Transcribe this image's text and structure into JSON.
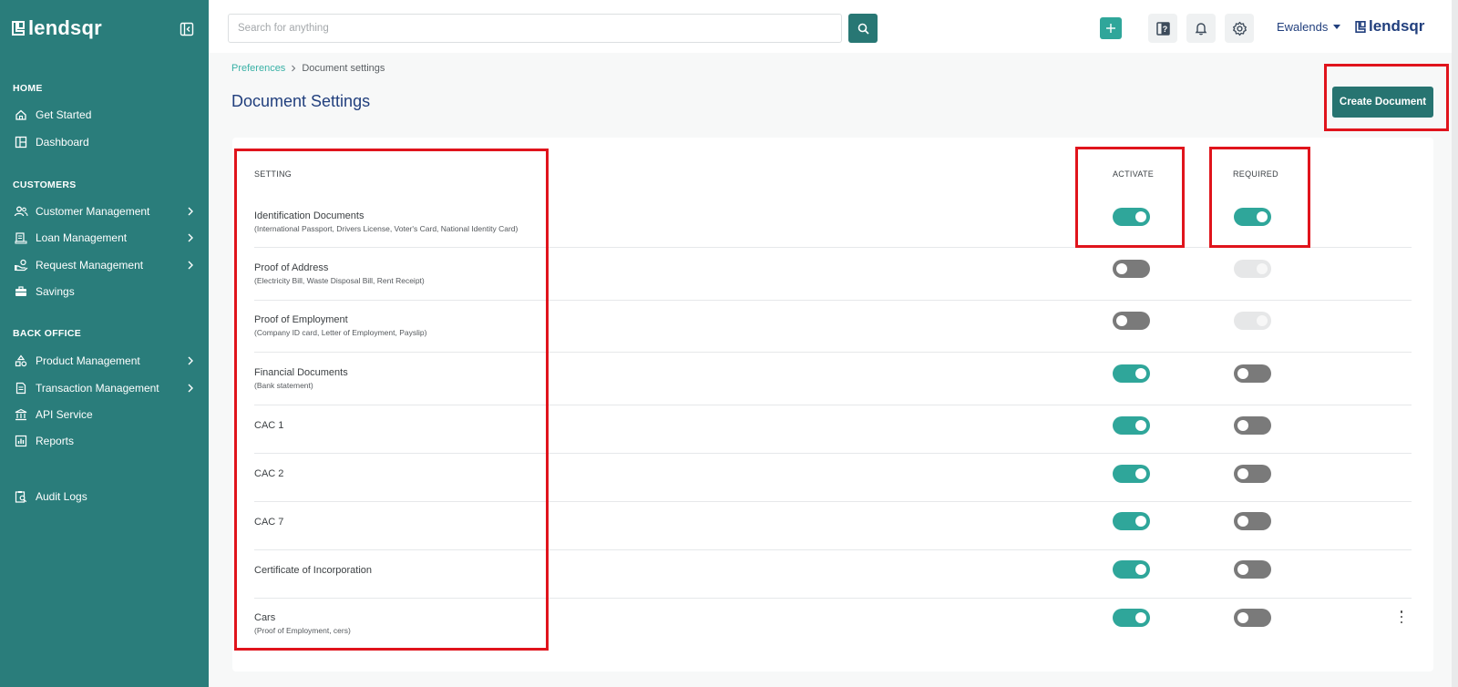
{
  "colors": {
    "sidebar_bg": "#2a7d7b",
    "accent": "#2fa69a",
    "primary_dark": "#277471",
    "title_blue": "#213f7d",
    "highlight_red": "#e0141c"
  },
  "sidebar": {
    "brand": "lendsqr",
    "sections": {
      "home": "HOME",
      "customers": "CUSTOMERS",
      "back_office": "BACK OFFICE"
    },
    "items": [
      {
        "label": "Get Started",
        "icon": "home-icon"
      },
      {
        "label": "Dashboard",
        "icon": "dashboard-icon"
      },
      {
        "label": "Customer Management",
        "icon": "users-icon",
        "has_submenu": true
      },
      {
        "label": "Loan Management",
        "icon": "loan-icon",
        "has_submenu": true
      },
      {
        "label": "Request Management",
        "icon": "request-icon",
        "has_submenu": true
      },
      {
        "label": "Savings",
        "icon": "briefcase-icon"
      },
      {
        "label": "Product Management",
        "icon": "product-icon",
        "has_submenu": true
      },
      {
        "label": "Transaction Management",
        "icon": "transaction-icon",
        "has_submenu": true
      },
      {
        "label": "API Service",
        "icon": "bank-icon"
      },
      {
        "label": "Reports",
        "icon": "report-icon"
      },
      {
        "label": "Audit Logs",
        "icon": "audit-icon"
      }
    ]
  },
  "topbar": {
    "search_placeholder": "Search for anything",
    "user_name": "Ewalends",
    "brand": "lendsqr",
    "icons": [
      "search-icon",
      "plus-icon",
      "help-book-icon",
      "bell-icon",
      "gear-icon"
    ]
  },
  "breadcrumb": {
    "parent": "Preferences",
    "current": "Document settings"
  },
  "page": {
    "title": "Document Settings",
    "create_button": "Create Document"
  },
  "table": {
    "headers": {
      "setting": "SETTING",
      "activate": "ACTIVATE",
      "required": "REQUIRED"
    },
    "rows": [
      {
        "title": "Identification Documents",
        "subtitle": "(International Passport, Drivers License, Voter's Card, National Identity Card)",
        "activate": "on",
        "required": "on"
      },
      {
        "title": "Proof of Address",
        "subtitle": "(Electricity Bill, Waste Disposal Bill, Rent Receipt)",
        "activate": "off",
        "required": "disabled"
      },
      {
        "title": "Proof of Employment",
        "subtitle": "(Company ID card, Letter of Employment, Payslip)",
        "activate": "off",
        "required": "disabled"
      },
      {
        "title": "Financial Documents",
        "subtitle": "(Bank statement)",
        "activate": "on",
        "required": "off"
      },
      {
        "title": "CAC 1",
        "subtitle": "",
        "activate": "on",
        "required": "off"
      },
      {
        "title": "CAC 2",
        "subtitle": "",
        "activate": "on",
        "required": "off"
      },
      {
        "title": "CAC 7",
        "subtitle": "",
        "activate": "on",
        "required": "off"
      },
      {
        "title": "Certificate of Incorporation",
        "subtitle": "",
        "activate": "on",
        "required": "off"
      },
      {
        "title": "Cars",
        "subtitle": "(Proof of Employment, cers)",
        "activate": "on",
        "required": "off"
      }
    ]
  }
}
